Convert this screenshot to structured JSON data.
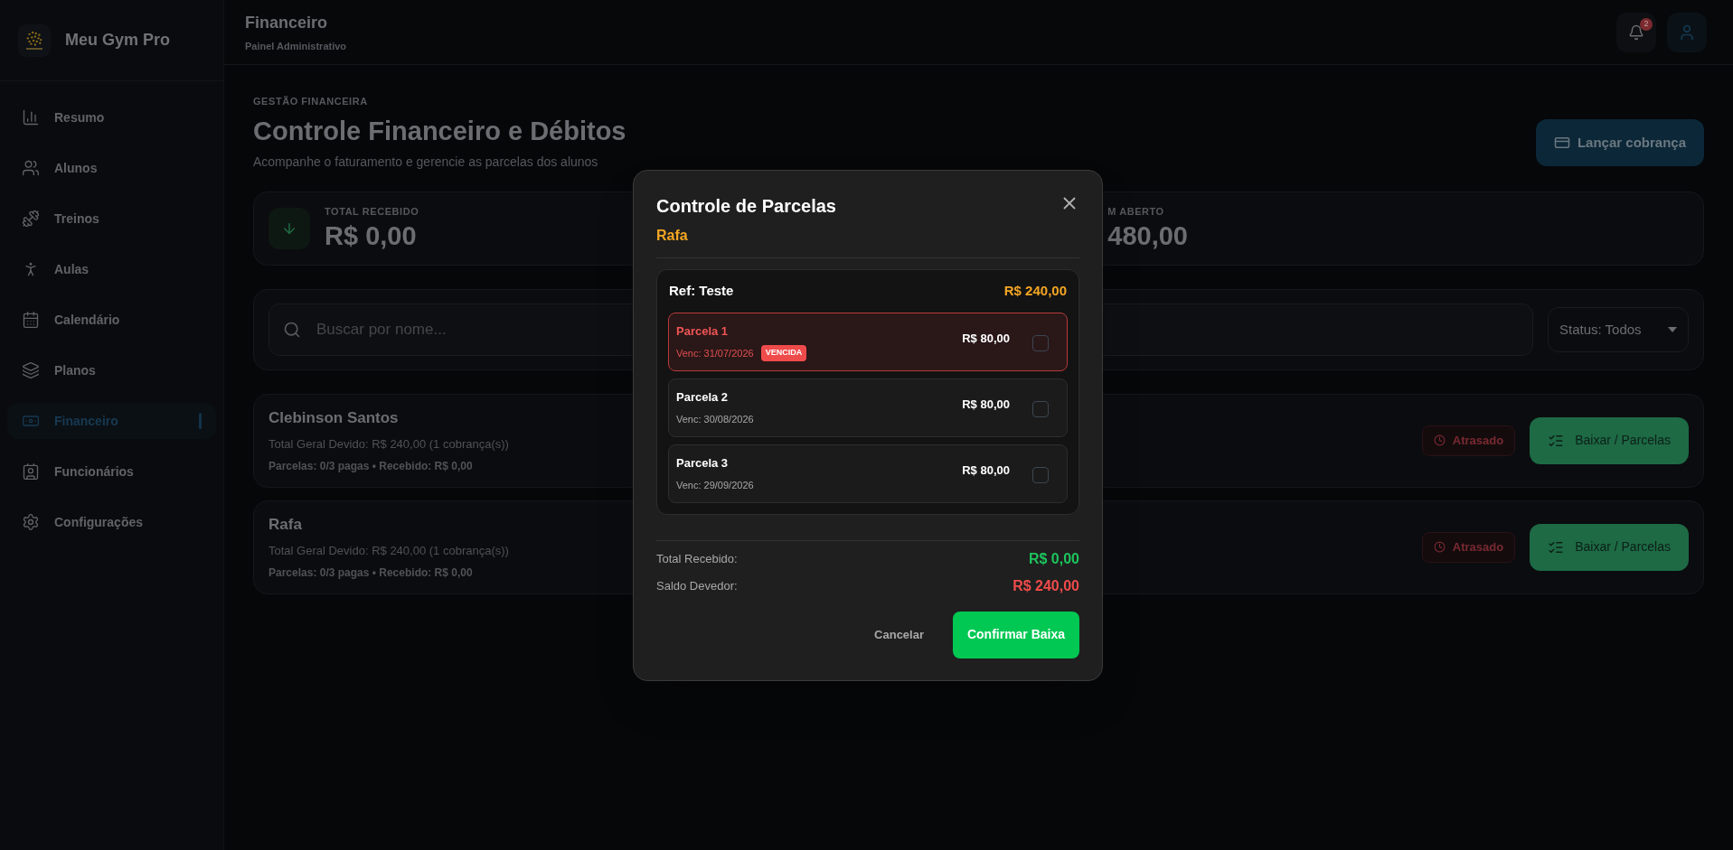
{
  "sidebar": {
    "brand": "Meu Gym Pro",
    "items": [
      {
        "label": "Resumo",
        "selected": false
      },
      {
        "label": "Alunos",
        "selected": false
      },
      {
        "label": "Treinos",
        "selected": false
      },
      {
        "label": "Aulas",
        "selected": false
      },
      {
        "label": "Calendário",
        "selected": false
      },
      {
        "label": "Planos",
        "selected": false
      },
      {
        "label": "Financeiro",
        "selected": true
      },
      {
        "label": "Funcionários",
        "selected": false
      },
      {
        "label": "Configurações",
        "selected": false
      }
    ]
  },
  "header": {
    "title": "Financeiro",
    "subtitle": "Painel Administrativo",
    "notification_count": "2"
  },
  "page": {
    "eyebrow": "GESTÃO FINANCEIRA",
    "title": "Controle Financeiro e Débitos",
    "subtitle": "Acompanhe o faturamento e gerencie as parcelas dos alunos",
    "action": "Lançar cobrança"
  },
  "stats": [
    {
      "label": "TOTAL RECEBIDO",
      "value": "R$ 0,00"
    },
    {
      "label": "M ABERTO",
      "value": "480,00"
    }
  ],
  "filters": {
    "search_placeholder": "Buscar por nome...",
    "status": "Status: Todos"
  },
  "students": [
    {
      "name": "Clebinson Santos",
      "total": "Total Geral Devido: R$ 240,00 (1 cobrança(s))",
      "summary": "Parcelas: 0/3 pagas • Recebido: R$ 0,00",
      "status": "Atrasado",
      "action": "Baixar / Parcelas"
    },
    {
      "name": "Rafa",
      "total": "Total Geral Devido: R$ 240,00 (1 cobrança(s))",
      "summary": "Parcelas: 0/3 pagas • Recebido: R$ 0,00",
      "status": "Atrasado",
      "action": "Baixar / Parcelas"
    }
  ],
  "modal": {
    "title": "Controle de Parcelas",
    "student": "Rafa",
    "ref": "Ref: Teste",
    "ref_total": "R$ 240,00",
    "installments": [
      {
        "name": "Parcela 1",
        "amount": "R$ 80,00",
        "due": "Venc: 31/07/2026",
        "overdue": true,
        "badge": "VENCIDA",
        "checked": false
      },
      {
        "name": "Parcela 2",
        "amount": "R$ 80,00",
        "due": "Venc: 30/08/2026",
        "overdue": false,
        "checked": false
      },
      {
        "name": "Parcela 3",
        "amount": "R$ 80,00",
        "due": "Venc: 29/09/2026",
        "overdue": false,
        "checked": false
      }
    ],
    "totals": [
      {
        "label": "Total Recebido:",
        "value": "R$ 0,00",
        "kind": "received"
      },
      {
        "label": "Saldo Devedor:",
        "value": "R$ 240,00",
        "kind": "due"
      }
    ],
    "cancel": "Cancelar",
    "confirm": "Confirmar Baixa"
  }
}
